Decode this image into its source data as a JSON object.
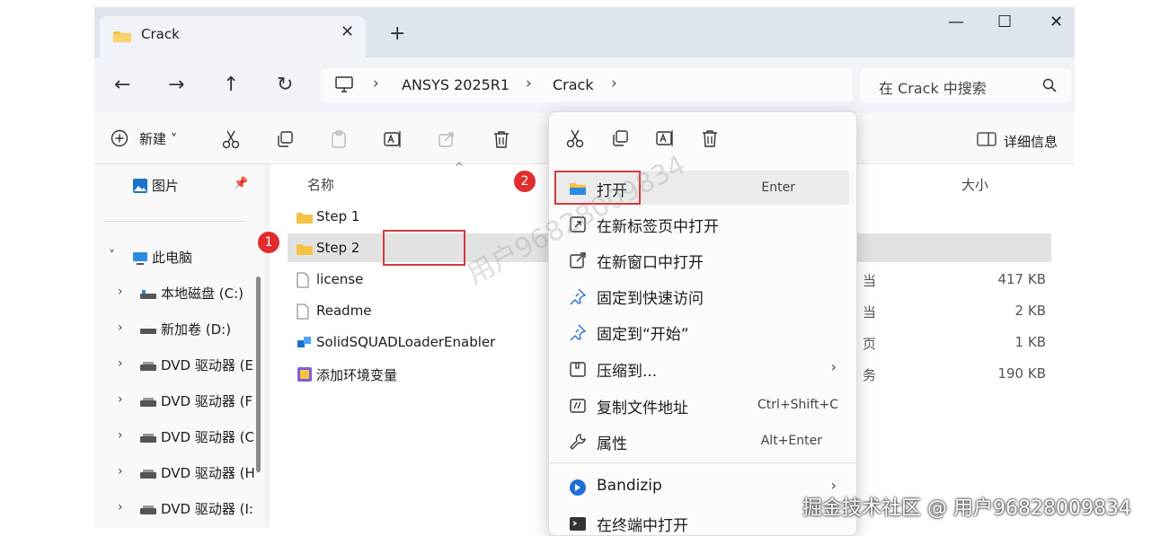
{
  "window": {
    "tab_title": "Crack",
    "tab_close": "✕",
    "new_tab": "+",
    "minimize": "—",
    "maximize": "☐",
    "close": "✕"
  },
  "nav": {
    "back": "←",
    "forward": "→",
    "up": "↑",
    "refresh": "↻",
    "breadcrumb": [
      "ANSYS 2025R1",
      "Crack"
    ],
    "separator": "›",
    "search_placeholder": "在 Crack 中搜索"
  },
  "toolbar": {
    "new_label": "新建 ˅",
    "details_label": "详细信息"
  },
  "sidebar": {
    "items": [
      {
        "label": "图片",
        "chevron": "",
        "icon": "pictures-icon"
      },
      {
        "label": "此电脑",
        "chevron": "˅",
        "icon": "computer-icon"
      },
      {
        "label": "本地磁盘 (C:)",
        "chevron": "›",
        "icon": "drive-icon"
      },
      {
        "label": "新加卷 (D:)",
        "chevron": "›",
        "icon": "drive-icon"
      },
      {
        "label": "DVD 驱动器 (E",
        "chevron": "›",
        "icon": "dvd-icon"
      },
      {
        "label": "DVD 驱动器 (F",
        "chevron": "›",
        "icon": "dvd-icon"
      },
      {
        "label": "DVD 驱动器 (C",
        "chevron": "›",
        "icon": "dvd-icon"
      },
      {
        "label": "DVD 驱动器 (H",
        "chevron": "›",
        "icon": "dvd-icon"
      },
      {
        "label": "DVD 驱动器 (I:",
        "chevron": "›",
        "icon": "dvd-icon"
      }
    ]
  },
  "files": {
    "columns": {
      "name": "名称",
      "size": "大小"
    },
    "rows": [
      {
        "name": "Step 1",
        "type": "",
        "size": "",
        "icon": "folder-icon"
      },
      {
        "name": "Step 2",
        "type": "",
        "size": "",
        "icon": "folder-icon"
      },
      {
        "name": "license",
        "type": "当",
        "size": "417 KB",
        "icon": "file-icon"
      },
      {
        "name": "Readme",
        "type": "当",
        "size": "2 KB",
        "icon": "file-icon"
      },
      {
        "name": "SolidSQUADLoaderEnabler",
        "type": "页",
        "size": "1 KB",
        "icon": "registry-icon"
      },
      {
        "name": "添加环境变量",
        "type": "务",
        "size": "190 KB",
        "icon": "batch-icon"
      }
    ]
  },
  "badges": {
    "one": "1",
    "two": "2"
  },
  "context_menu": {
    "items": [
      {
        "label": "打开",
        "shortcut": "Enter",
        "icon": "folder-open-icon"
      },
      {
        "label": "在新标签页中打开",
        "shortcut": "",
        "icon": "new-tab-icon"
      },
      {
        "label": "在新窗口中打开",
        "shortcut": "",
        "icon": "new-window-icon"
      },
      {
        "label": "固定到快速访问",
        "shortcut": "",
        "icon": "pin-icon"
      },
      {
        "label": "固定到“开始”",
        "shortcut": "",
        "icon": "pin-icon"
      },
      {
        "label": "压缩到...",
        "shortcut": "›",
        "icon": "zip-icon"
      },
      {
        "label": "复制文件地址",
        "shortcut": "Ctrl+Shift+C",
        "icon": "copy-path-icon"
      },
      {
        "label": "属性",
        "shortcut": "Alt+Enter",
        "icon": "properties-icon"
      },
      {
        "label": "Bandizip",
        "shortcut": "›",
        "icon": "bandizip-icon"
      },
      {
        "label": "在终端中打开",
        "shortcut": "",
        "icon": "terminal-icon"
      }
    ]
  },
  "overlay": {
    "watermark": "用户96828009834",
    "credit": "掘金技术社区 @ 用户96828009834"
  },
  "colors": {
    "accent": "#0067c0",
    "highlight": "#d23a3a",
    "folder": "#f6c244"
  }
}
